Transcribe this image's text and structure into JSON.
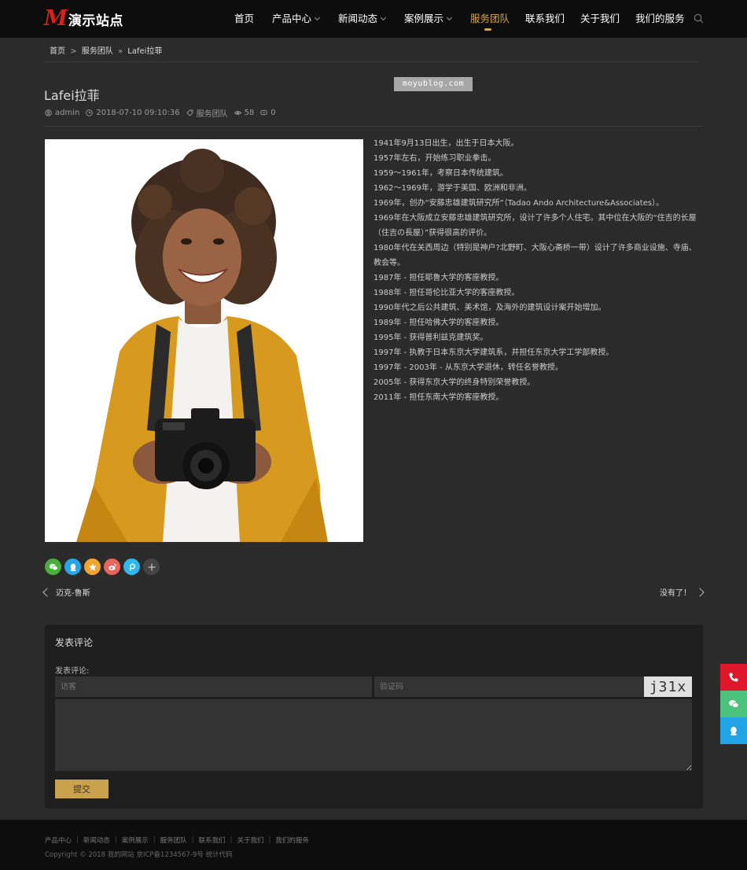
{
  "header": {
    "logo_mark": "M",
    "logo_text": "演示站点",
    "nav": [
      {
        "label": "首页"
      },
      {
        "label": "产品中心"
      },
      {
        "label": "新闻动态"
      },
      {
        "label": "案例展示"
      },
      {
        "label": "服务团队"
      },
      {
        "label": "联系我们"
      },
      {
        "label": "关于我们"
      },
      {
        "label": "我们的服务"
      }
    ],
    "active_nav": "服务团队",
    "accent": "#d4a94f",
    "search_icon": "search-icon"
  },
  "breadcrumb": {
    "home": "首页",
    "sep1": ">",
    "category": "服务团队",
    "sep2": "»",
    "current": "Lafei拉菲"
  },
  "watermark": "moyublog.com",
  "post": {
    "title": "Lafei拉菲",
    "author": "admin",
    "date": "2018-07-10 09:10:36",
    "category": "服务团队",
    "views": "58",
    "comments": "0"
  },
  "bio": [
    "1941年9月13日出生，出生于日本大阪。",
    "1957年左右，开始练习职业拳击。",
    "1959～1961年，考察日本传统建筑。",
    "1962～1969年，游学于美国、欧洲和非洲。",
    "1969年，创办“安藤忠雄建筑研究所”（Tadao Ando Architecture&Associates）。",
    "1969年在大阪成立安藤忠雄建筑研究所，设计了许多个人住宅。其中位在大阪的“住吉的长屋（住吉の長屋）”获得很高的评价。",
    "1980年代在关西周边（特别是神户?北野町、大阪心斋桥一带）设计了许多商业设施、寺庙、教会等。",
    "1987年 - 担任耶鲁大学的客座教授。",
    "1988年 - 担任哥伦比亚大学的客座教授。",
    "1990年代之后公共建筑、美术馆，及海外的建筑设计案开始增加。",
    "1989年 - 担任哈佛大学的客座教授。",
    "1995年 - 获得普利兹克建筑奖。",
    "1997年 - 执教于日本东京大学建筑系，并担任东京大学工学部教授。",
    "1997年 - 2003年 - 从东京大学退休，转任名誉教授。",
    "2005年 - 获得东京大学的终身特别荣誉教授。",
    "2011年 - 担任东南大学的客座教授。"
  ],
  "share": [
    {
      "icon": "wechat-icon",
      "color": "#47b03a"
    },
    {
      "icon": "qq-icon",
      "color": "#2aa5e4"
    },
    {
      "icon": "qzone-icon",
      "color": "#f3a32f"
    },
    {
      "icon": "weibo-icon",
      "color": "#e8655e"
    },
    {
      "icon": "tieba-icon",
      "color": "#2fb7ee"
    },
    {
      "icon": "more-icon",
      "color": "#444444"
    }
  ],
  "pager": {
    "prev": "迈克-鲁斯",
    "next": "没有了！"
  },
  "comment": {
    "title": "发表评论",
    "label": "发表评论:",
    "name_placeholder": "访客",
    "captcha_placeholder": "验证码",
    "captcha_text": "j31x",
    "submit": "提交",
    "submit_color": "#c8a24d"
  },
  "footer": {
    "links": [
      "产品中心",
      "新闻动态",
      "案例展示",
      "服务团队",
      "联系我们",
      "关于我们",
      "我们的服务"
    ],
    "copyright": "Copyright © 2018 我的网站 京ICP备1234567-9号 统计代码"
  },
  "floating": [
    {
      "icon": "phone-icon",
      "color": "#e0172b"
    },
    {
      "icon": "wechat-icon",
      "color": "#4dc27c"
    },
    {
      "icon": "qq-icon",
      "color": "#22a3e5"
    }
  ]
}
